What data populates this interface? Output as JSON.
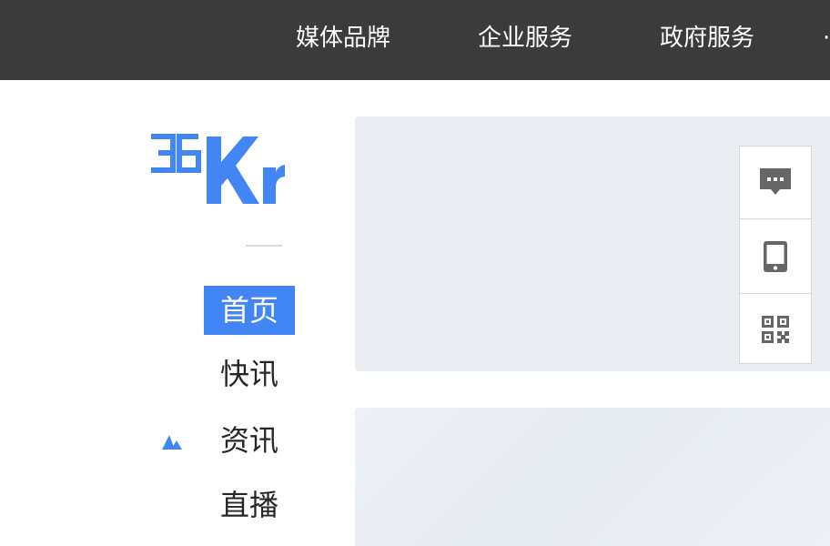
{
  "top_nav": {
    "items": [
      {
        "label": "媒体品牌"
      },
      {
        "label": "企业服务"
      },
      {
        "label": "政府服务"
      }
    ]
  },
  "logo": {
    "text": "36Kr",
    "color": "#4285f4"
  },
  "side_nav": {
    "items": [
      {
        "label": "首页",
        "active": true
      },
      {
        "label": "快讯",
        "active": false
      },
      {
        "label": "资讯",
        "active": false
      },
      {
        "label": "直播",
        "active": false
      }
    ],
    "accent_color": "#4285f4"
  },
  "side_tools": [
    {
      "icon": "message-icon"
    },
    {
      "icon": "tablet-icon"
    },
    {
      "icon": "qrcode-icon"
    }
  ]
}
